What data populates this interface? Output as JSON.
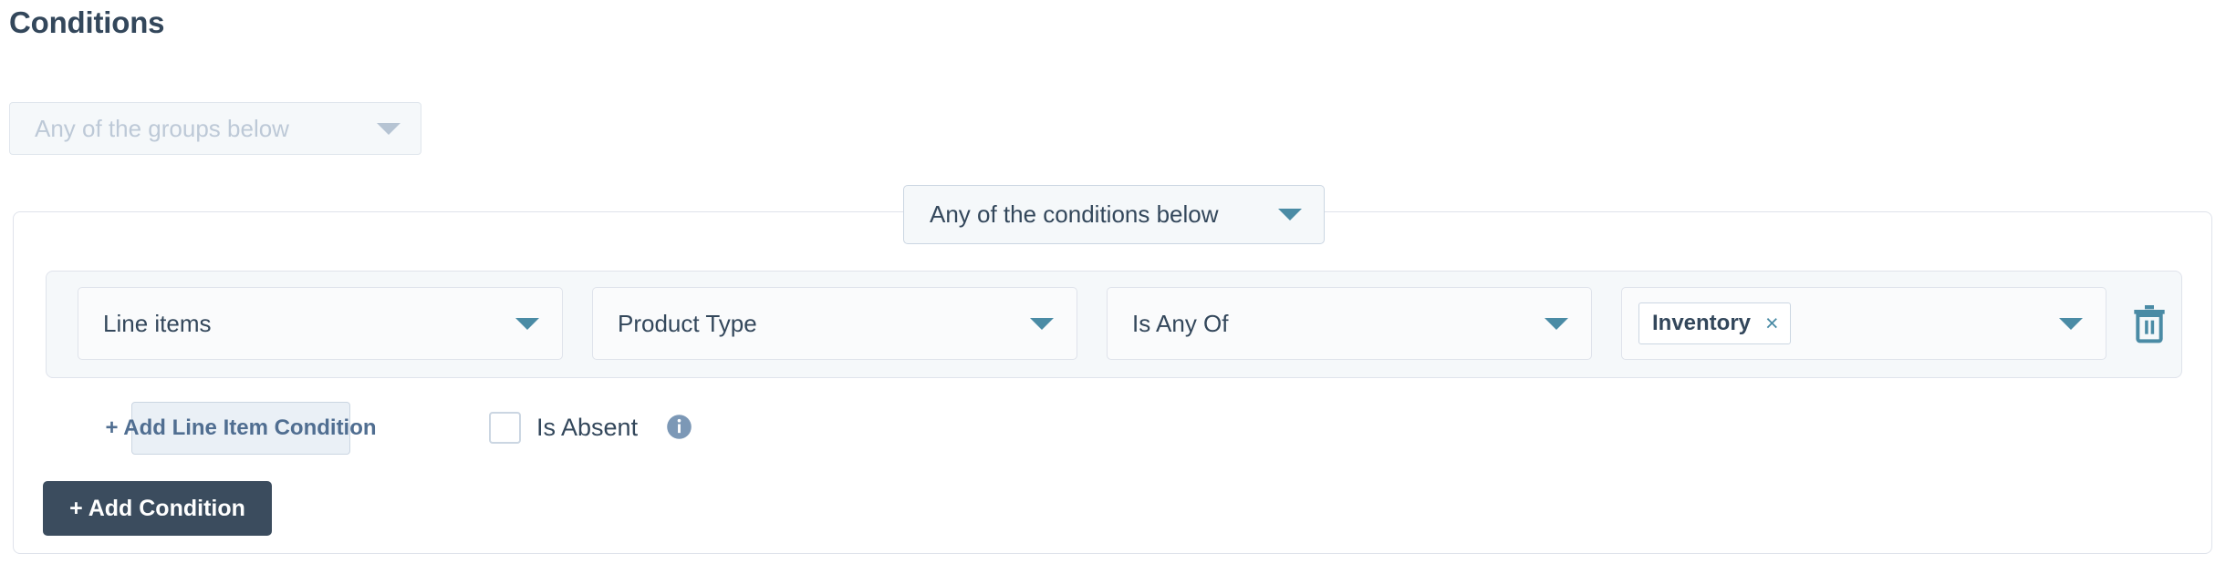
{
  "page": {
    "title": "Conditions"
  },
  "group_logic": {
    "value": "Any of the groups below",
    "caret_icon": "chevron-down-icon",
    "disabled": true
  },
  "condition_logic": {
    "value": "Any of the conditions below",
    "caret_icon": "chevron-down-icon"
  },
  "condition_row": {
    "object": {
      "value": "Line items",
      "caret_icon": "chevron-down-icon"
    },
    "property": {
      "value": "Product Type",
      "caret_icon": "chevron-down-icon"
    },
    "operator": {
      "value": "Is Any Of",
      "caret_icon": "chevron-down-icon"
    },
    "value_field": {
      "chips": [
        {
          "label": "Inventory",
          "remove_icon": "close-icon",
          "remove_glyph": "×"
        }
      ],
      "caret_icon": "chevron-down-icon"
    },
    "delete": {
      "icon": "trash-icon",
      "color": "#4a8ba5"
    }
  },
  "actions": {
    "add_line_item_condition_label": "+ Add Line Item Condition",
    "is_absent_label": "Is Absent",
    "is_absent_checked": false,
    "is_absent_info_icon": "info-icon",
    "add_condition_label": "+ Add Condition"
  },
  "colors": {
    "text_dark": "#33475b",
    "accent_teal": "#4a8ba5",
    "border": "#dfe3eb",
    "field_bg": "#f5f8fa",
    "primary_button_bg": "#3b4c5e",
    "secondary_button_bg": "#eaf0f6",
    "disabled_text": "#bdc9d7"
  }
}
